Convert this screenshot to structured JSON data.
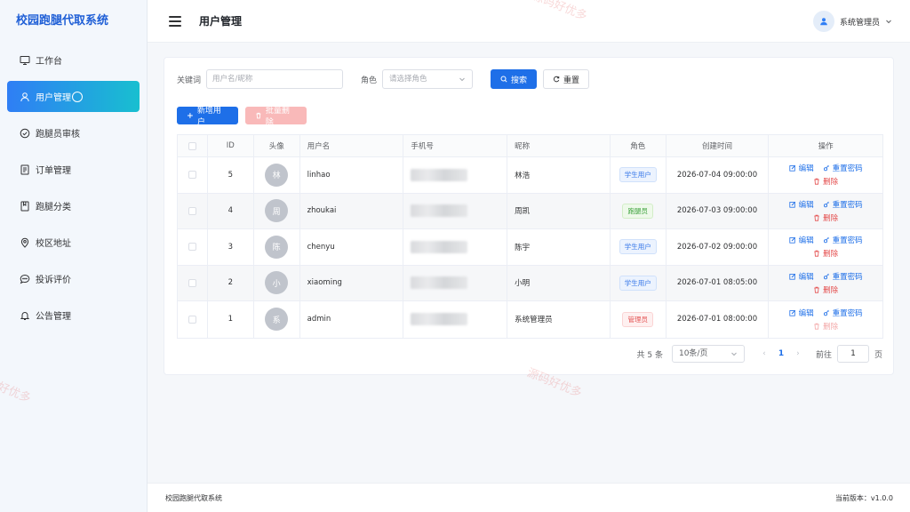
{
  "app": {
    "brand": "校园跑腿代取系统"
  },
  "header": {
    "title": "用户管理",
    "user_name": "系统管理员"
  },
  "sidebar": {
    "items": [
      {
        "label": "工作台",
        "icon": "monitor-icon",
        "active": false
      },
      {
        "label": "用户管理",
        "icon": "user-icon",
        "active": true
      },
      {
        "label": "跑腿员审核",
        "icon": "check-circle-icon",
        "active": false
      },
      {
        "label": "订单管理",
        "icon": "document-icon",
        "active": false
      },
      {
        "label": "跑腿分类",
        "icon": "notebook-icon",
        "active": false
      },
      {
        "label": "校区地址",
        "icon": "location-icon",
        "active": false
      },
      {
        "label": "投诉评价",
        "icon": "chat-icon",
        "active": false
      },
      {
        "label": "公告管理",
        "icon": "bell-icon",
        "active": false
      }
    ]
  },
  "search": {
    "keyword_label": "关键词",
    "keyword_placeholder": "用户名/昵称",
    "role_label": "角色",
    "role_placeholder": "请选择角色",
    "search_button": "搜索",
    "reset_button": "重置"
  },
  "actions": {
    "add_button": "新增用户",
    "batch_delete_button": "批量删除"
  },
  "table": {
    "headers": {
      "id": "ID",
      "avatar": "头像",
      "username": "用户名",
      "phone": "手机号",
      "nickname": "昵称",
      "role": "角色",
      "created": "创建时间",
      "ops": "操作"
    },
    "rows": [
      {
        "id": "5",
        "avatar": "林",
        "username": "linhao",
        "nickname": "林浩",
        "role": "学生用户",
        "role_type": "blue",
        "created": "2026-07-04 09:00:00",
        "delete_disabled": false
      },
      {
        "id": "4",
        "avatar": "周",
        "username": "zhoukai",
        "nickname": "周凯",
        "role": "跑腿员",
        "role_type": "green",
        "created": "2026-07-03 09:00:00",
        "delete_disabled": false
      },
      {
        "id": "3",
        "avatar": "陈",
        "username": "chenyu",
        "nickname": "陈宇",
        "role": "学生用户",
        "role_type": "blue",
        "created": "2026-07-02 09:00:00",
        "delete_disabled": false
      },
      {
        "id": "2",
        "avatar": "小",
        "username": "xiaoming",
        "nickname": "小明",
        "role": "学生用户",
        "role_type": "blue",
        "created": "2026-07-01 08:05:00",
        "delete_disabled": false
      },
      {
        "id": "1",
        "avatar": "系",
        "username": "admin",
        "nickname": "系统管理员",
        "role": "管理员",
        "role_type": "red",
        "created": "2026-07-01 08:00:00",
        "delete_disabled": true
      }
    ],
    "op_edit": "编辑",
    "op_reset_pwd": "重置密码",
    "op_delete": "删除"
  },
  "pagination": {
    "total": "共 5 条",
    "page_size": "10条/页",
    "current_page": "1",
    "goto_label": "前往",
    "goto_value": "1",
    "page_suffix": "页"
  },
  "footer": {
    "left": "校园跑腿代取系统",
    "right": "当前版本：v1.0.0"
  },
  "watermark": "源码好优多",
  "colors": {
    "primary": "#1e6fe8",
    "danger": "#e44b4b",
    "active_gradient_start": "#2f7ef5",
    "active_gradient_end": "#18bfd0"
  }
}
